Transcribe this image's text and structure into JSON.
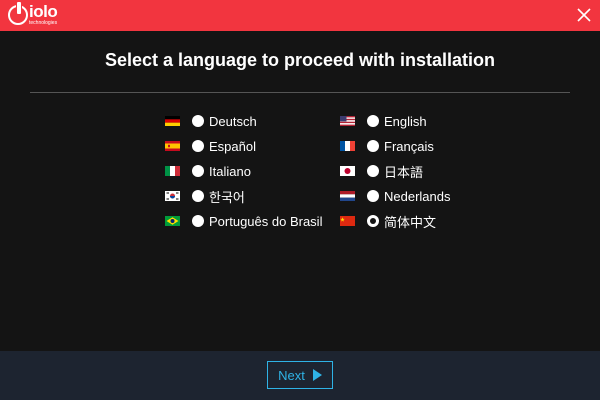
{
  "app": {
    "logo_text": "iolo",
    "logo_subtext": "technologies"
  },
  "heading": "Select a language to proceed with installation",
  "languages": [
    {
      "label": "Deutsch",
      "flag": "flag-de-icon",
      "selected": false
    },
    {
      "label": "Español",
      "flag": "flag-es-icon",
      "selected": false
    },
    {
      "label": "Italiano",
      "flag": "flag-it-icon",
      "selected": false
    },
    {
      "label": "한국어",
      "flag": "flag-kr-icon",
      "selected": false
    },
    {
      "label": "Português do Brasil",
      "flag": "flag-br-icon",
      "selected": false
    },
    {
      "label": "English",
      "flag": "flag-us-icon",
      "selected": false
    },
    {
      "label": "Français",
      "flag": "flag-fr-icon",
      "selected": false
    },
    {
      "label": "日本語",
      "flag": "flag-jp-icon",
      "selected": false
    },
    {
      "label": "Nederlands",
      "flag": "flag-nl-icon",
      "selected": false
    },
    {
      "label": "简体中文",
      "flag": "flag-cn-icon",
      "selected": true
    }
  ],
  "footer": {
    "next_label": "Next"
  },
  "colors": {
    "titlebar": "#f2353f",
    "background": "#141414",
    "footer": "#1d2430",
    "accent": "#2fb3e6"
  }
}
